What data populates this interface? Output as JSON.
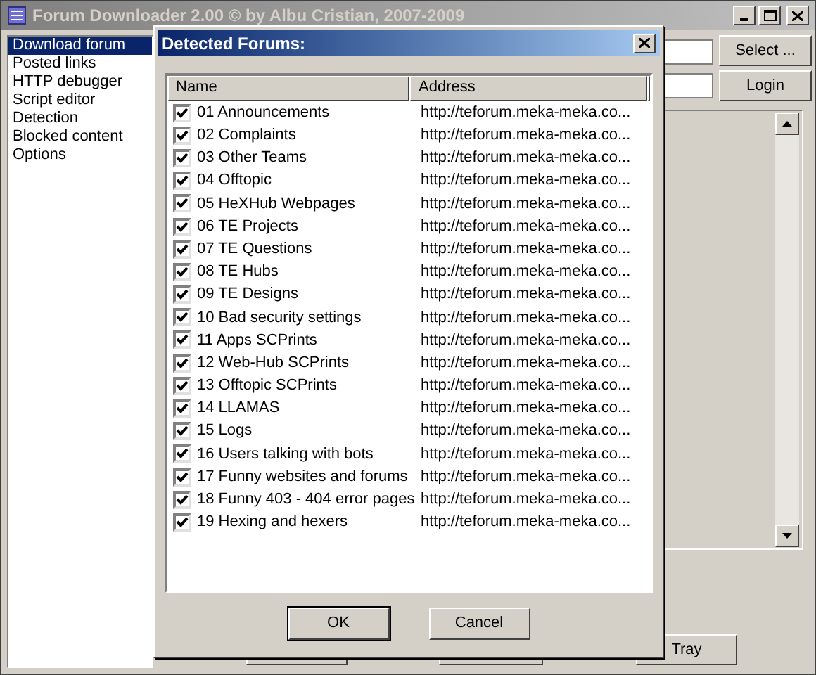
{
  "window": {
    "title": "Forum Downloader 2.00 © by Albu Cristian, 2007-2009"
  },
  "sidebar": {
    "items": [
      {
        "label": "Download forum",
        "selected": true
      },
      {
        "label": "Posted links",
        "selected": false
      },
      {
        "label": "HTTP debugger",
        "selected": false
      },
      {
        "label": "Script editor",
        "selected": false
      },
      {
        "label": "Detection",
        "selected": false
      },
      {
        "label": "Blocked content",
        "selected": false
      },
      {
        "label": "Options",
        "selected": false
      }
    ]
  },
  "right_panel": {
    "buttons": [
      "Select ...",
      "Login"
    ]
  },
  "bottom_buttons": [
    "Tray"
  ],
  "dialog": {
    "title": "Detected Forums:",
    "columns": [
      "Name",
      "Address"
    ],
    "rows": [
      {
        "name": "01 Announcements",
        "address": "http://teforum.meka-meka.co...",
        "checked": true
      },
      {
        "name": "02 Complaints",
        "address": "http://teforum.meka-meka.co...",
        "checked": true
      },
      {
        "name": "03 Other Teams",
        "address": "http://teforum.meka-meka.co...",
        "checked": true
      },
      {
        "name": "04 Offtopic",
        "address": "http://teforum.meka-meka.co...",
        "checked": true
      },
      {
        "name": "05 HeXHub Webpages",
        "address": "http://teforum.meka-meka.co...",
        "checked": true
      },
      {
        "name": "06 TE Projects",
        "address": "http://teforum.meka-meka.co...",
        "checked": true
      },
      {
        "name": "07 TE Questions",
        "address": "http://teforum.meka-meka.co...",
        "checked": true
      },
      {
        "name": "08 TE Hubs",
        "address": "http://teforum.meka-meka.co...",
        "checked": true
      },
      {
        "name": "09 TE Designs",
        "address": "http://teforum.meka-meka.co...",
        "checked": true
      },
      {
        "name": "10 Bad security settings",
        "address": "http://teforum.meka-meka.co...",
        "checked": true
      },
      {
        "name": "11 Apps SCPrints",
        "address": "http://teforum.meka-meka.co...",
        "checked": true
      },
      {
        "name": "12 Web-Hub SCPrints",
        "address": "http://teforum.meka-meka.co...",
        "checked": true
      },
      {
        "name": "13 Offtopic SCPrints",
        "address": "http://teforum.meka-meka.co...",
        "checked": true
      },
      {
        "name": "14 LLAMAS",
        "address": "http://teforum.meka-meka.co...",
        "checked": true
      },
      {
        "name": "15 Logs",
        "address": "http://teforum.meka-meka.co...",
        "checked": true
      },
      {
        "name": "16 Users talking with bots",
        "address": "http://teforum.meka-meka.co...",
        "checked": true
      },
      {
        "name": "17 Funny websites and forums",
        "address": "http://teforum.meka-meka.co...",
        "checked": true
      },
      {
        "name": "18 Funny 403 - 404 error pages",
        "address": "http://teforum.meka-meka.co...",
        "checked": true
      },
      {
        "name": "19 Hexing and hexers",
        "address": "http://teforum.meka-meka.co...",
        "checked": true
      }
    ],
    "buttons": [
      "OK",
      "Cancel"
    ]
  }
}
